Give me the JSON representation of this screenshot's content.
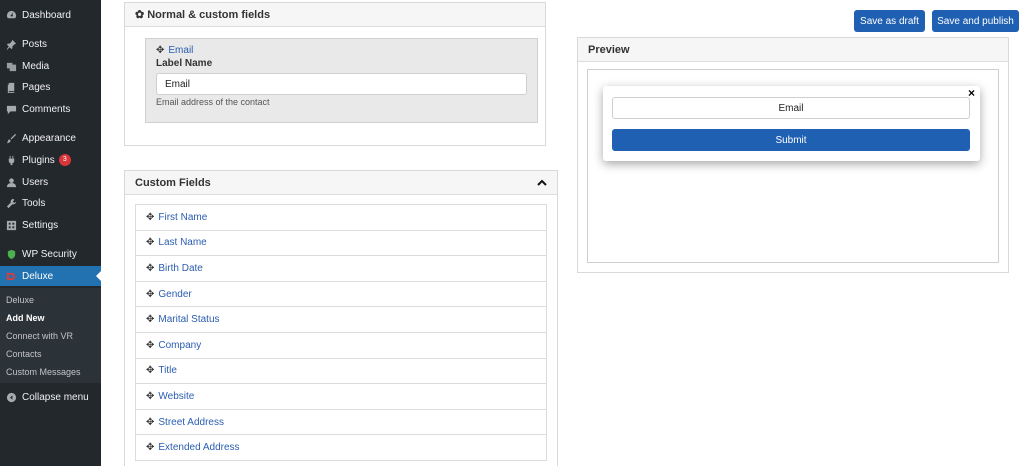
{
  "sidebar": {
    "items": [
      {
        "label": "Dashboard",
        "icon": "dashboard-icon"
      },
      {
        "label": "Posts",
        "icon": "pin-icon"
      },
      {
        "label": "Media",
        "icon": "media-icon"
      },
      {
        "label": "Pages",
        "icon": "pages-icon"
      },
      {
        "label": "Comments",
        "icon": "comments-icon"
      },
      {
        "label": "Appearance",
        "icon": "brush-icon"
      },
      {
        "label": "Plugins",
        "icon": "plug-icon",
        "badge": "3"
      },
      {
        "label": "Users",
        "icon": "users-icon"
      },
      {
        "label": "Tools",
        "icon": "wrench-icon"
      },
      {
        "label": "Settings",
        "icon": "settings-icon"
      },
      {
        "label": "WP Security",
        "icon": "shield-icon"
      },
      {
        "label": "Deluxe",
        "icon": "deluxe-icon"
      },
      {
        "label": "Collapse menu",
        "icon": "collapse-icon"
      }
    ],
    "submenu": [
      "Deluxe",
      "Add New",
      "Connect with VR",
      "Contacts",
      "Custom Messages"
    ]
  },
  "normal_fields": {
    "title": "Normal & custom fields",
    "field": {
      "name": "Email",
      "label_heading": "Label Name",
      "label_value": "Email",
      "help": "Email address of the contact"
    }
  },
  "custom_fields": {
    "title": "Custom Fields",
    "items": [
      "First Name",
      "Last Name",
      "Birth Date",
      "Gender",
      "Marital Status",
      "Company",
      "Title",
      "Website",
      "Street Address",
      "Extended Address"
    ]
  },
  "actions": {
    "draft": "Save as draft",
    "publish": "Save and publish"
  },
  "preview": {
    "title": "Preview",
    "input_value": "Email",
    "submit": "Submit",
    "close": "×"
  },
  "colors": {
    "accent": "#2060b3",
    "sidebar_bg": "#23282d",
    "active_menu": "#2271b1",
    "badge": "#d63638"
  }
}
